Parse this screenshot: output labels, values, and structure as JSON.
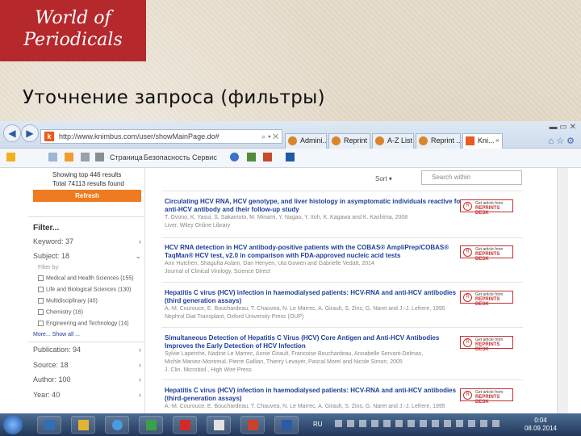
{
  "slide": {
    "badge_line1": "World of",
    "badge_line2": "Periodicals",
    "title": "Уточнение запроса (фильтры)"
  },
  "browser": {
    "url": "http://www.knimbus.com/user/showMainPage.do#",
    "tabs": [
      "Admini...",
      "Reprint ...",
      "A-Z List",
      "Reprint ...",
      "Kni..."
    ],
    "command_items": [
      "Страница",
      "Безопасность",
      "Сервис"
    ]
  },
  "left_panel": {
    "showing_line1": "Showing top 446 results",
    "showing_line2": "Total 74113 results found",
    "refresh_label": "Refresh",
    "filter_title": "Filter...",
    "keyword": "Keyword: 37",
    "subject": "Subject: 18",
    "filter_by": "Filter by:",
    "subject_items": [
      "Medical and Health Sciences (155)",
      "Life and Biological Sciences (130)",
      "Multidisciplinary (40)",
      "Chemistry (16)",
      "Engineering and Technology (14)"
    ],
    "more": "More... Show all ...",
    "publication": "Publication: 94",
    "source": "Source: 18",
    "author": "Author: 100",
    "year": "Year: 40"
  },
  "results": {
    "sort_label": "Sort",
    "search_within_placeholder": "Search within",
    "reprints": {
      "line1": "Get article from",
      "line2": "REPRINTS DESK"
    },
    "items": [
      {
        "title1": "Circulating HCV RNA, HCV genotype, and liver histology in asymptomatic individuals reactive for",
        "title2": "anti-HCV antibody and their follow-up study",
        "meta1": "T. Ovono, K. Yasui, S. Sakamoto, M. Minami, Y. Nagao, Y. Itoh, K. Kagawa and K. Kashima, 2008",
        "meta2": "Liver, Wiley Online Library"
      },
      {
        "title1": "HCV RNA detection in HCV antibody-positive patients with the COBAS® AmpliPrep/COBAS®",
        "title2": "TaqMan® HCV test, v2.0 in comparison with FDA-approved nucleic acid tests",
        "meta1": "Ann Hutchen, Shagufta Aslam, Dan Henyen, Uta Gowen and Gabrielle Vedatt, 2014",
        "meta2": "Journal of Clinical Virology, Science Direct"
      },
      {
        "title1": "Hepatitis C virus (HCV) infection in haemodialysed patients: HCV-RNA and anti-HCV antibodies",
        "title2": "(third generation assays)",
        "meta1": "A.-M. Courouce, E. Bouchardeau, T. Chauvea, N. Le Marrec, A. Girault, S. Zins, G. Naret and J.-J. Lefrere, 1995",
        "meta2": "Nephrol Dial Transplant, Oxford University Press (OUP)"
      },
      {
        "title1": "Simultaneous Detection of Hepatitis C Virus (HCV) Core Antigen and Anti-HCV Antibodies",
        "title2": "Improves the Early Detection of HCV Infection",
        "meta1": "Sylvie Laperche, Nadine Le Marrec, Annie Girault, Francoise Bouchardeau, Annabelle Servant-Delmas,",
        "meta2": "Michle Maniez-Montreuil, Pierre Gallian, Thierry Levayer, Pascal Morel and Nicole Simon, 2005",
        "meta3": "J. Clin. Microbiol., High Wire Press"
      },
      {
        "title1": "Hepatitis C virus (HCV) infection in haemodialysed patients: HCV-RNA and anti-HCV antibodies",
        "title2": "(third-generation assays)",
        "meta1": "A.-M. Courouce, E. Bouchardeau, T. Chauvea, N. Le Marrec, A. Girault, S. Zins, G. Naret and J.-J. Lefrere, 1995"
      }
    ]
  },
  "taskbar": {
    "lang": "RU",
    "time": "0:04",
    "date": "08.09.2014"
  },
  "colors": {
    "badge": "#b5282b",
    "refresh": "#f07a1f",
    "link": "#1e3f99",
    "reprints": "#c43030"
  }
}
